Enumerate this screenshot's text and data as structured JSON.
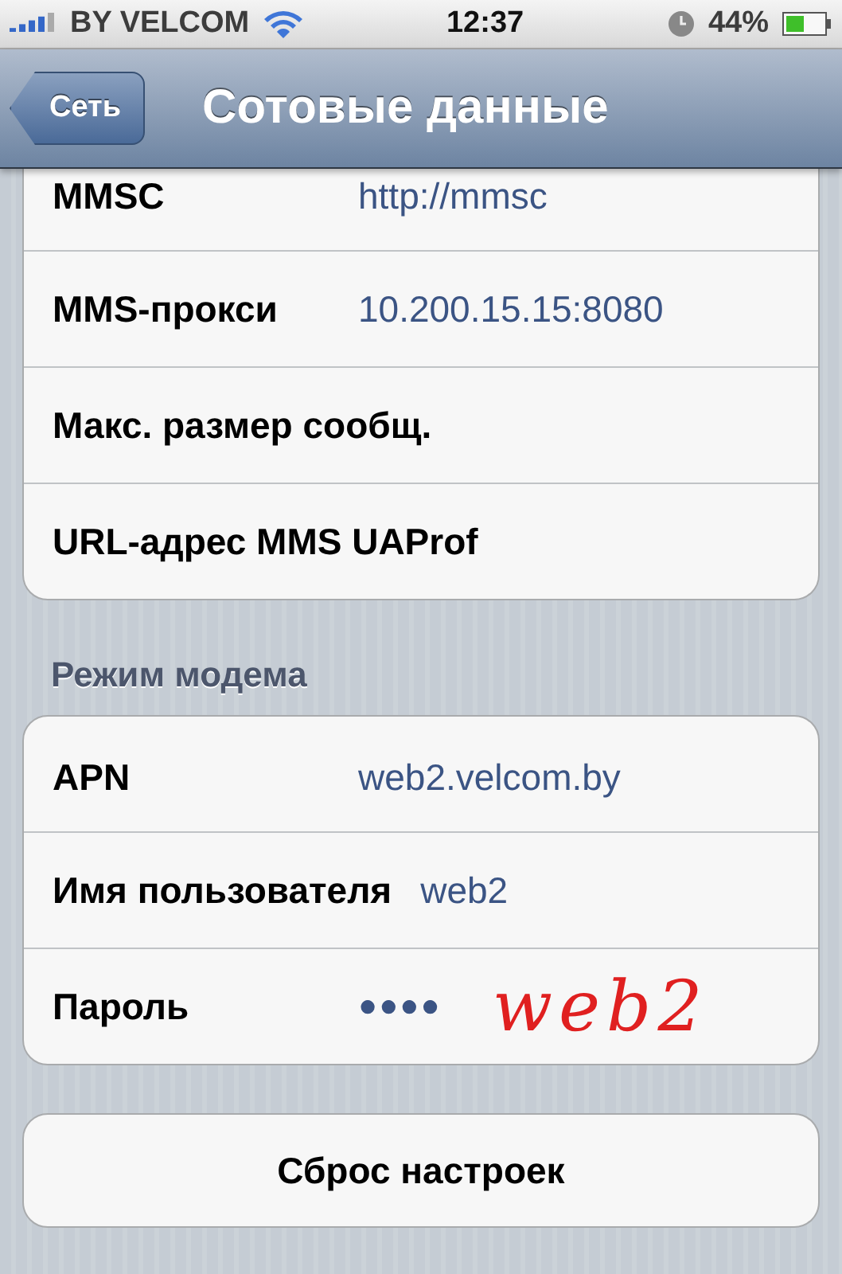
{
  "status_bar": {
    "carrier": "BY VELCOM",
    "time": "12:37",
    "battery": "44%"
  },
  "nav": {
    "back": "Сеть",
    "title": "Сотовые данные"
  },
  "groups": [
    {
      "rows": [
        {
          "label": "MMSC",
          "value": "http://mmsc"
        },
        {
          "label": "MMS-прокси",
          "value": "10.200.15.15:8080"
        },
        {
          "label": "Макс. размер сообщ.",
          "value": null
        },
        {
          "label": "URL-адрес MMS UAProf",
          "value": null
        }
      ]
    },
    {
      "header": "Режим модема",
      "rows": [
        {
          "label": "APN",
          "value": "web2.velcom.by"
        },
        {
          "label": "Имя пользователя",
          "value": "web2"
        },
        {
          "label": "Пароль",
          "value": "●●●●",
          "annotation": "web2"
        }
      ]
    }
  ],
  "reset_button": "Сброс настроек"
}
